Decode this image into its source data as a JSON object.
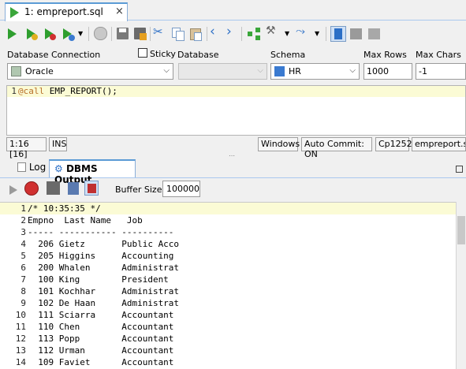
{
  "editor_tab": {
    "title": "1: empreport.sql",
    "close": "×"
  },
  "toolbar": {
    "icons": [
      "run-statement-icon",
      "run-script-icon",
      "debug-icon",
      "run-menu-icon",
      "commit-icon",
      "stop-icon",
      "save-icon",
      "save-as-icon",
      "cut-icon",
      "copy-icon",
      "paste-icon",
      "undo-icon",
      "back-icon",
      "forward-icon",
      "share-icon",
      "tools-icon",
      "format-icon",
      "dbms-output-icon",
      "grid-icon",
      "panel-icon"
    ]
  },
  "connection": {
    "db_connection_label": "Database Connection",
    "sticky_label": "Sticky",
    "database_label": "Database",
    "schema_label": "Schema",
    "max_rows_label": "Max Rows",
    "max_chars_label": "Max Chars",
    "db_connection_value": "Oracle",
    "database_value": "",
    "schema_value": "HR",
    "max_rows_value": "1000",
    "max_chars_value": "-1"
  },
  "editor": {
    "line_number": "1",
    "keyword": "@call",
    "statement": " EMP_REPORT();"
  },
  "status": {
    "position": "1:16 [16]",
    "mode": "INS",
    "line_endings": "Windows",
    "auto_commit": "Auto Commit: ON",
    "encoding": "Cp1252",
    "file": "empreport.sql"
  },
  "lower_tabs": [
    {
      "label": "Log"
    },
    {
      "label": "DBMS Output"
    }
  ],
  "dbms_toolbar": {
    "buffer_label": "Buffer Size:",
    "buffer_value": "100000"
  },
  "output_lines": [
    {
      "n": "1",
      "t": "/* 10:35:35 */"
    },
    {
      "n": "2",
      "t": "Empno  Last Name   Job"
    },
    {
      "n": "3",
      "t": "----- ----------- ----------"
    },
    {
      "n": "4",
      "t": "  206 Gietz       Public Acco"
    },
    {
      "n": "5",
      "t": "  205 Higgins     Accounting"
    },
    {
      "n": "6",
      "t": "  200 Whalen      Administrat"
    },
    {
      "n": "7",
      "t": "  100 King        President"
    },
    {
      "n": "8",
      "t": "  101 Kochhar     Administrat"
    },
    {
      "n": "9",
      "t": "  102 De Haan     Administrat"
    },
    {
      "n": "10",
      "t": "  111 Sciarra     Accountant"
    },
    {
      "n": "11",
      "t": "  110 Chen        Accountant"
    },
    {
      "n": "12",
      "t": "  113 Popp        Accountant"
    },
    {
      "n": "13",
      "t": "  112 Urman       Accountant"
    },
    {
      "n": "14",
      "t": "  109 Faviet      Accountant"
    }
  ],
  "colors": {
    "accent": "#5b9bd5",
    "run_green": "#2e9e2e",
    "current_line": "#fbfbd5",
    "keyword": "#b8702a"
  }
}
